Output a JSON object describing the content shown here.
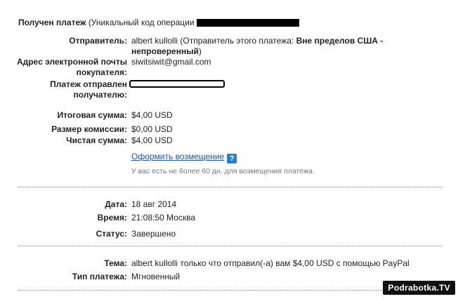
{
  "header": {
    "title": "Получен платеж",
    "subtitle": "(Уникальный код операции"
  },
  "sender": {
    "label": "Отправитель:",
    "name": "albert kullolli",
    "note_prefix": "(Отправитель этого платежа:",
    "note_bold": "Вне пределов США - непроверенный",
    "note_suffix": ")"
  },
  "email": {
    "label": "Адрес электронной почты покупателя:",
    "value": "siwitsiwit@gmail.com"
  },
  "recipient": {
    "label": "Платеж отправлен получателю:"
  },
  "amounts": {
    "total_label": "Итоговая сумма:",
    "total_value": "$4,00 USD",
    "fee_label": "Размер комиссии:",
    "fee_value": "$0,00 USD",
    "net_label": "Чистая сумма:",
    "net_value": "$4,00 USD"
  },
  "refund": {
    "link": "Оформить возмещение",
    "help_icon": "question-icon",
    "note": "У вас есть не более 60 дн. для возмещения платежа."
  },
  "details": {
    "date_label": "Дата:",
    "date_value": "18 авг 2014",
    "time_label": "Время:",
    "time_value": "21:08:50 Москва",
    "status_label": "Статус:",
    "status_value": "Завершено"
  },
  "message": {
    "subject_label": "Тема:",
    "subject_value": "albert kullolli только что отправил(-а) вам $4,00 USD с помощью PayPal",
    "type_label": "Тип платежа:",
    "type_value": "Мгновенный"
  },
  "watermark": "Podrabotka.TV",
  "colors": {
    "link": "#1a55a5",
    "help_icon_bg": "#2b7bd0"
  }
}
